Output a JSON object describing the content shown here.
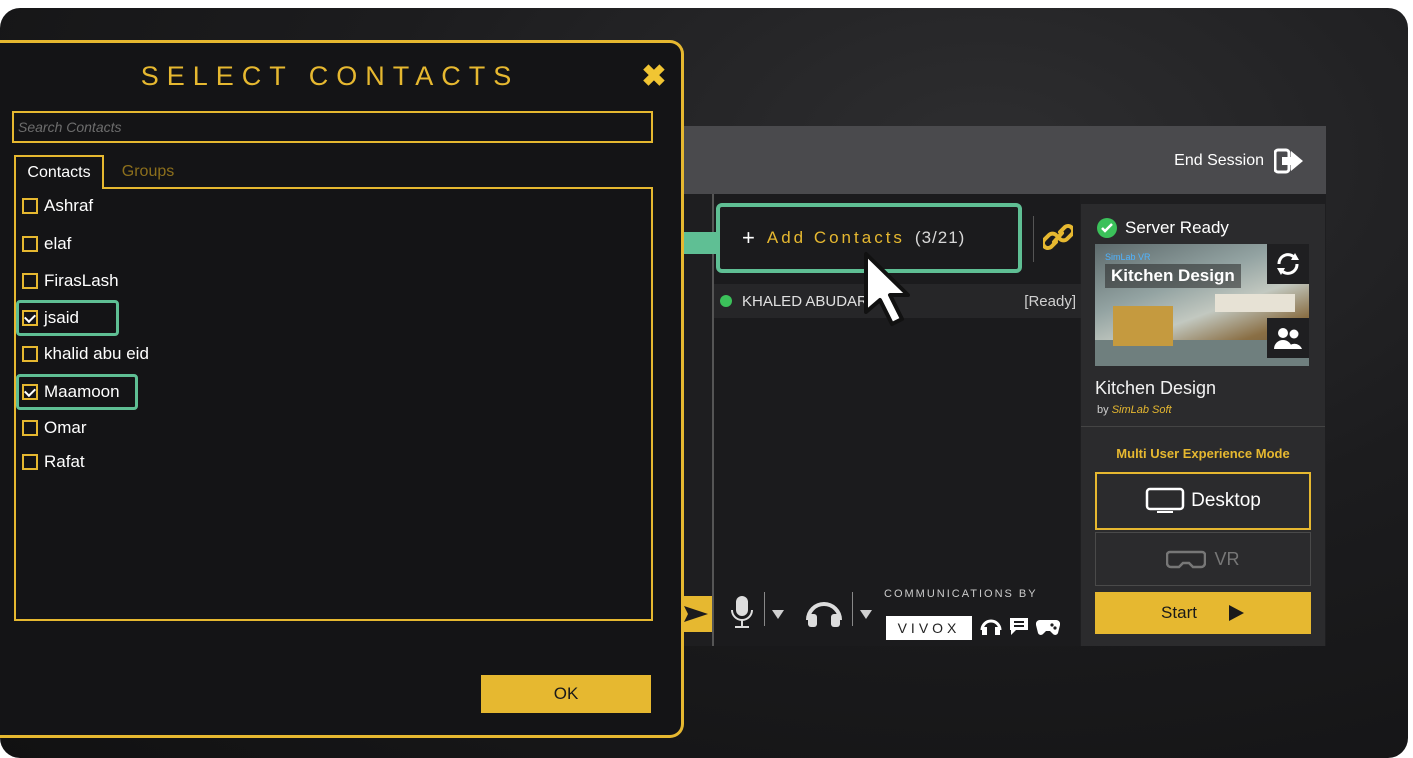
{
  "dialog": {
    "title": "SELECT CONTACTS",
    "close_icon": "close-icon",
    "search_placeholder": "Search Contacts",
    "tabs": [
      {
        "label": "Contacts",
        "active": true
      },
      {
        "label": "Groups",
        "active": false
      }
    ],
    "contacts": [
      {
        "name": "Ashraf",
        "checked": false
      },
      {
        "name": "elaf",
        "checked": false
      },
      {
        "name": "FirasLash",
        "checked": false
      },
      {
        "name": "jsaid",
        "checked": true
      },
      {
        "name": "khalid abu eid",
        "checked": false
      },
      {
        "name": "Maamoon",
        "checked": true
      },
      {
        "name": "Omar",
        "checked": false
      },
      {
        "name": "Rafat",
        "checked": false
      }
    ],
    "ok_label": "OK"
  },
  "session": {
    "end_session_label": "End Session",
    "add_contacts": {
      "plus": "+",
      "label": "Add Contacts",
      "count": "(3/21)"
    },
    "participant": {
      "name": "KHALED ABUDARI",
      "status": "[Ready]"
    },
    "server_status": "Server Ready",
    "experience": {
      "thumb_small": "SimLab VR",
      "thumb_title": "Kitchen Design",
      "title": "Kitchen Design",
      "by": "by",
      "author": "SimLab Soft"
    },
    "mode_title": "Multi User Experience Mode",
    "desktop_label": "Desktop",
    "vr_label": "VR",
    "start_label": "Start",
    "comms": {
      "caption": "COMMUNICATIONS BY",
      "brand": "VIVOX"
    }
  },
  "colors": {
    "accent": "#e6b830",
    "highlight": "#5fbf94",
    "ready": "#3bc15a"
  }
}
